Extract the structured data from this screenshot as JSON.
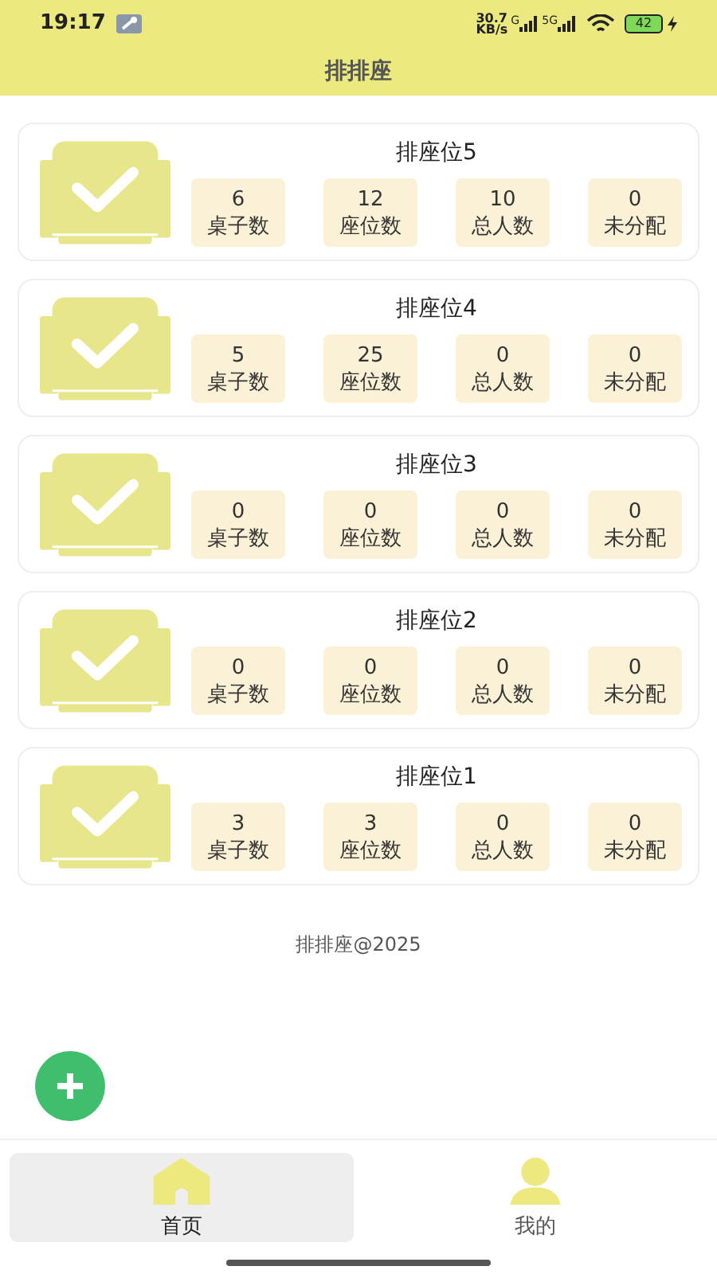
{
  "status_bar": {
    "time": "19:17",
    "speed": "30.7",
    "speed_unit": "KB/s",
    "network_1": "G",
    "network_2": "5G",
    "battery": "42"
  },
  "header": {
    "title": "排排座"
  },
  "cards": [
    {
      "title": "排座位5",
      "stats": [
        {
          "value": "6",
          "label": "桌子数"
        },
        {
          "value": "12",
          "label": "座位数"
        },
        {
          "value": "10",
          "label": "总人数"
        },
        {
          "value": "0",
          "label": "未分配"
        }
      ]
    },
    {
      "title": "排座位4",
      "stats": [
        {
          "value": "5",
          "label": "桌子数"
        },
        {
          "value": "25",
          "label": "座位数"
        },
        {
          "value": "0",
          "label": "总人数"
        },
        {
          "value": "0",
          "label": "未分配"
        }
      ]
    },
    {
      "title": "排座位3",
      "stats": [
        {
          "value": "0",
          "label": "桌子数"
        },
        {
          "value": "0",
          "label": "座位数"
        },
        {
          "value": "0",
          "label": "总人数"
        },
        {
          "value": "0",
          "label": "未分配"
        }
      ]
    },
    {
      "title": "排座位2",
      "stats": [
        {
          "value": "0",
          "label": "桌子数"
        },
        {
          "value": "0",
          "label": "座位数"
        },
        {
          "value": "0",
          "label": "总人数"
        },
        {
          "value": "0",
          "label": "未分配"
        }
      ]
    },
    {
      "title": "排座位1",
      "stats": [
        {
          "value": "3",
          "label": "桌子数"
        },
        {
          "value": "3",
          "label": "座位数"
        },
        {
          "value": "0",
          "label": "总人数"
        },
        {
          "value": "0",
          "label": "未分配"
        }
      ]
    }
  ],
  "footer": "排排座@2025",
  "tabs": [
    {
      "label": "首页",
      "kind": "home",
      "selected": true
    },
    {
      "label": "我的",
      "kind": "profile",
      "selected": false
    }
  ]
}
